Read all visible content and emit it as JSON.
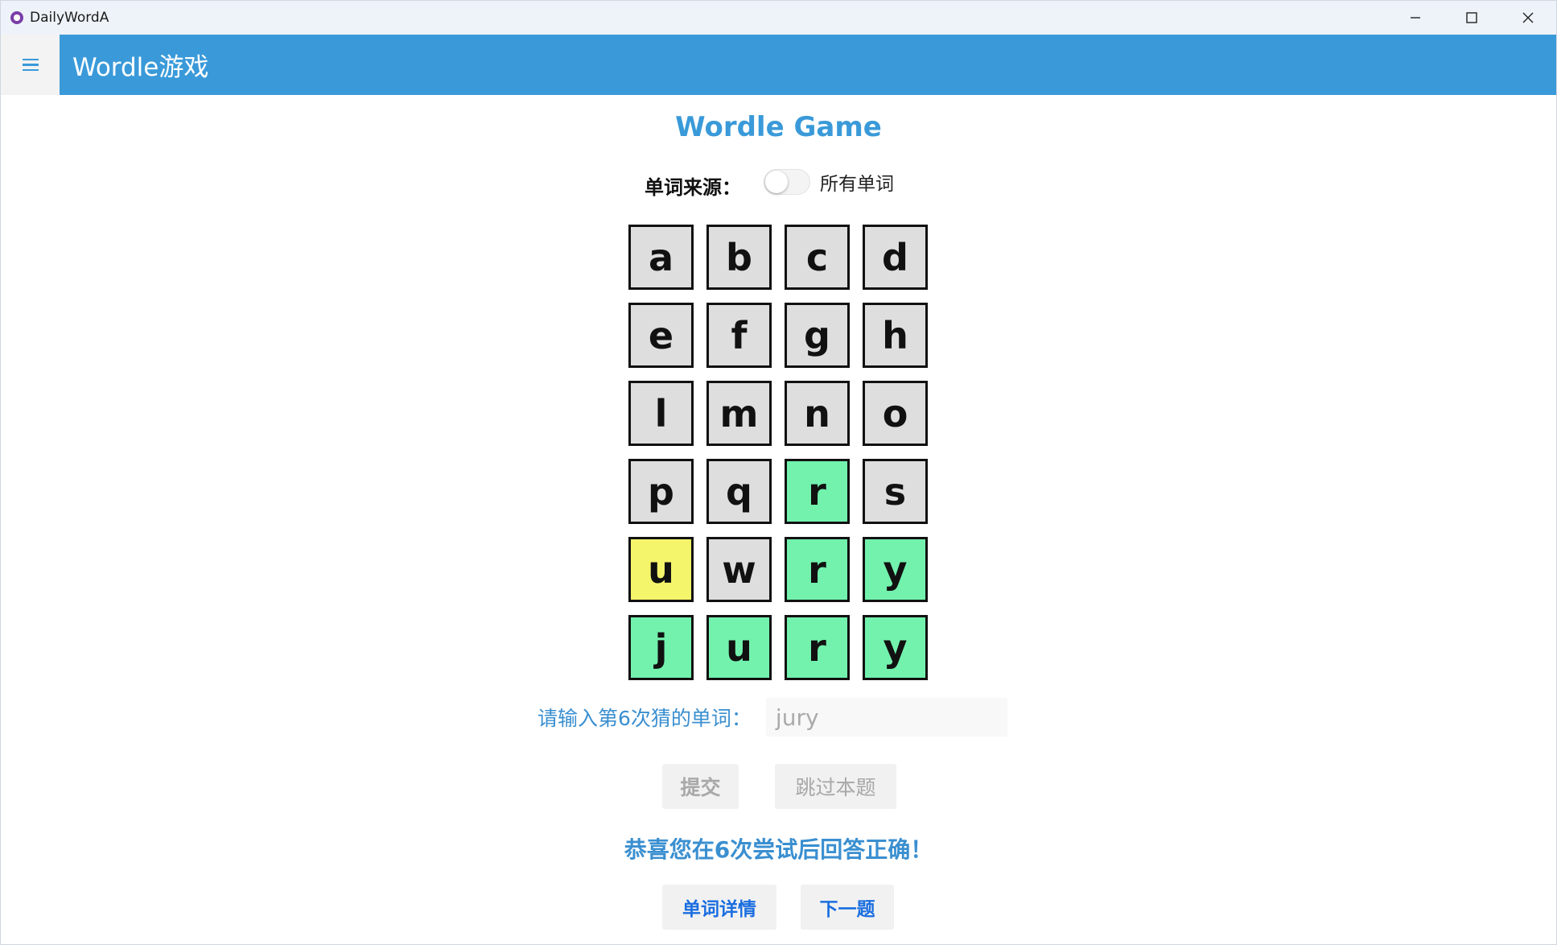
{
  "window": {
    "title": "DailyWordA"
  },
  "header": {
    "title": "Wordle游戏"
  },
  "game": {
    "title": "Wordle Game",
    "source_label": "单词来源：",
    "source_toggle_label": "所有单词",
    "source_toggle_on": false
  },
  "grid": {
    "rows": [
      [
        {
          "letter": "a",
          "state": "absent"
        },
        {
          "letter": "b",
          "state": "absent"
        },
        {
          "letter": "c",
          "state": "absent"
        },
        {
          "letter": "d",
          "state": "absent"
        }
      ],
      [
        {
          "letter": "e",
          "state": "absent"
        },
        {
          "letter": "f",
          "state": "absent"
        },
        {
          "letter": "g",
          "state": "absent"
        },
        {
          "letter": "h",
          "state": "absent"
        }
      ],
      [
        {
          "letter": "l",
          "state": "absent"
        },
        {
          "letter": "m",
          "state": "absent"
        },
        {
          "letter": "n",
          "state": "absent"
        },
        {
          "letter": "o",
          "state": "absent"
        }
      ],
      [
        {
          "letter": "p",
          "state": "absent"
        },
        {
          "letter": "q",
          "state": "absent"
        },
        {
          "letter": "r",
          "state": "correct"
        },
        {
          "letter": "s",
          "state": "absent"
        }
      ],
      [
        {
          "letter": "u",
          "state": "present"
        },
        {
          "letter": "w",
          "state": "absent"
        },
        {
          "letter": "r",
          "state": "correct"
        },
        {
          "letter": "y",
          "state": "correct"
        }
      ],
      [
        {
          "letter": "j",
          "state": "correct"
        },
        {
          "letter": "u",
          "state": "correct"
        },
        {
          "letter": "r",
          "state": "correct"
        },
        {
          "letter": "y",
          "state": "correct"
        }
      ]
    ],
    "colors": {
      "absent": "#dedede",
      "present": "#f5f56c",
      "correct": "#72f2ad"
    }
  },
  "input": {
    "label": "请输入第6次猜的单词：",
    "value": "jury"
  },
  "buttons": {
    "submit": "提交",
    "skip": "跳过本题",
    "details": "单词详情",
    "next": "下一题"
  },
  "result": {
    "message": "恭喜您在6次尝试后回答正确！"
  },
  "colors": {
    "accent": "#3a9ad9",
    "link": "#1a6ee0"
  }
}
